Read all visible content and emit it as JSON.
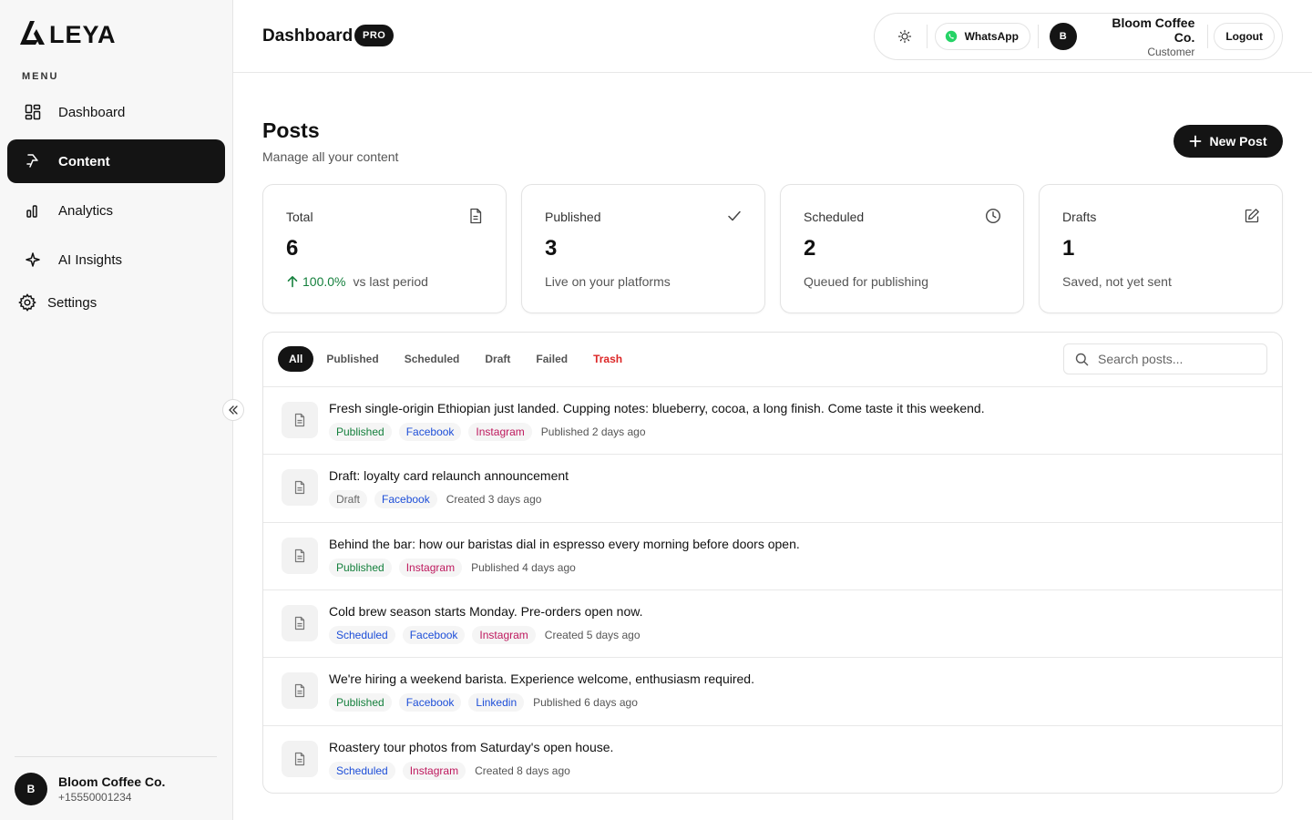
{
  "brand": {
    "name": "LEYA"
  },
  "sidebar": {
    "menu_label": "MENU",
    "items": [
      {
        "label": "Dashboard",
        "icon": "dashboard-icon",
        "active": false
      },
      {
        "label": "Content",
        "icon": "content-icon",
        "active": true
      },
      {
        "label": "Analytics",
        "icon": "analytics-icon",
        "active": false
      },
      {
        "label": "AI Insights",
        "icon": "sparkle-icon",
        "active": false
      }
    ],
    "settings_label": "Settings",
    "user": {
      "initial": "B",
      "name": "Bloom Coffee Co.",
      "phone": "+15550001234"
    }
  },
  "header": {
    "title": "Dashboard",
    "badge": "PRO",
    "whatsapp_label": "WhatsApp",
    "user": {
      "initial": "B",
      "name": "Bloom Coffee Co.",
      "role": "Customer"
    },
    "logout_label": "Logout"
  },
  "posts_page": {
    "title": "Posts",
    "subtitle": "Manage all your content",
    "new_post_label": "New Post"
  },
  "stats": [
    {
      "label": "Total",
      "value": "6",
      "trend": "100.0%",
      "foot": "vs last period",
      "icon": "document-icon"
    },
    {
      "label": "Published",
      "value": "3",
      "foot": "Live on your platforms",
      "icon": "check-icon"
    },
    {
      "label": "Scheduled",
      "value": "2",
      "foot": "Queued for publishing",
      "icon": "clock-icon"
    },
    {
      "label": "Drafts",
      "value": "1",
      "foot": "Saved, not yet sent",
      "icon": "edit-icon"
    }
  ],
  "tabs": [
    {
      "label": "All",
      "active": true
    },
    {
      "label": "Published",
      "active": false
    },
    {
      "label": "Scheduled",
      "active": false
    },
    {
      "label": "Draft",
      "active": false
    },
    {
      "label": "Failed",
      "active": false
    },
    {
      "label": "Trash",
      "active": false
    }
  ],
  "search": {
    "placeholder": "Search posts..."
  },
  "posts": [
    {
      "text": "Fresh single-origin Ethiopian just landed. Cupping notes: blueberry, cocoa, a long finish. Come taste it this weekend.",
      "status": "Published",
      "platforms": [
        "Facebook",
        "Instagram"
      ],
      "when": "Published 2 days ago"
    },
    {
      "text": "Draft: loyalty card relaunch announcement",
      "status": "Draft",
      "platforms": [
        "Facebook"
      ],
      "when": "Created 3 days ago"
    },
    {
      "text": "Behind the bar: how our baristas dial in espresso every morning before doors open.",
      "status": "Published",
      "platforms": [
        "Instagram"
      ],
      "when": "Published 4 days ago"
    },
    {
      "text": "Cold brew season starts Monday. Pre-orders open now.",
      "status": "Scheduled",
      "platforms": [
        "Facebook",
        "Instagram"
      ],
      "when": "Created 5 days ago"
    },
    {
      "text": "We're hiring a weekend barista. Experience welcome, enthusiasm required.",
      "status": "Published",
      "platforms": [
        "Facebook",
        "Linkedin"
      ],
      "when": "Published 6 days ago"
    },
    {
      "text": "Roastery tour photos from Saturday's open house.",
      "status": "Scheduled",
      "platforms": [
        "Instagram"
      ],
      "when": "Created 8 days ago"
    }
  ],
  "colors": {
    "accent": "#141414",
    "published": "#15803d",
    "scheduled": "#1d4ed8",
    "instagram": "#be185d",
    "trash": "#dc2626",
    "whatsapp": "#25d366"
  }
}
